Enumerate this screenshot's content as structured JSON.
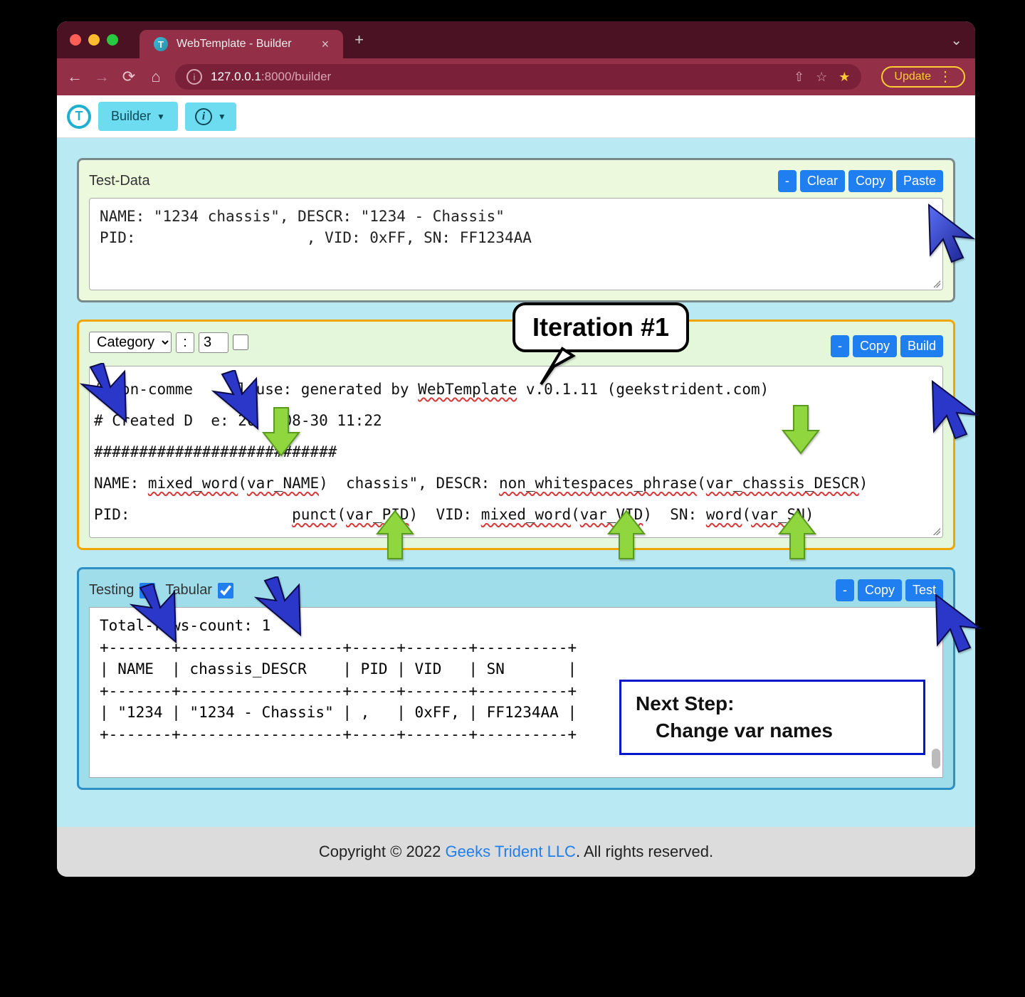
{
  "browser": {
    "tab_title": "WebTemplate - Builder",
    "url_host": "127.0.0.1",
    "url_port": ":8000",
    "url_path": "/builder",
    "update_label": "Update"
  },
  "appbar": {
    "builder_label": "Builder",
    "info_label": "i"
  },
  "panel1": {
    "title": "Test-Data",
    "btn_minus": "-",
    "btn_clear": "Clear",
    "btn_copy": "Copy",
    "btn_paste": "Paste",
    "content": "NAME: \"1234 chassis\", DESCR: \"1234 - Chassis\"\nPID:                   , VID: 0xFF, SN: FF1234AA"
  },
  "panel2": {
    "category_label": "Category",
    "colon": ":",
    "number_value": "3",
    "btn_minus": "-",
    "btn_copy": "Copy",
    "btn_build": "Build",
    "line1_a": "# Non-comme",
    "line1_b": "l use: generated by ",
    "line1_link": "WebTemplate",
    "line1_c": " v.0.1.11 (geekstrident.com)",
    "line2_a": "# Created D",
    "line2_b": "e: 20",
    "line2_c": "08-30 11:22",
    "line3": "###########################",
    "line4_a": "NAME: ",
    "line4_tok1": "mixed_word",
    "line4_b": "(",
    "line4_var1": "var_NAME",
    "line4_c": ")  chassis\", DESCR: ",
    "line4_tok2": "non_whitespaces_phrase",
    "line4_d": "(",
    "line4_var2": "var_chassis_DESCR",
    "line4_e": ")",
    "line5_a": "PID:                  ",
    "line5_tok1": "punct",
    "line5_b": "(",
    "line5_var1": "var_PID",
    "line5_c": ")  VID: ",
    "line5_tok2": "mixed_word",
    "line5_d": "(",
    "line5_var2": "var_VID",
    "line5_e": ")  SN: ",
    "line5_tok3": "word",
    "line5_f": "(",
    "line5_var3": "var_SN",
    "line5_g": ")"
  },
  "panel3": {
    "testing_label": "Testing",
    "tabular_label": "Tabular",
    "btn_minus": "-",
    "btn_copy": "Copy",
    "btn_test": "Test",
    "content": "Total-rows-count: 1\n+-------+------------------+-----+-------+----------+\n| NAME  | chassis_DESCR    | PID | VID   | SN       |\n+-------+------------------+-----+-------+----------+\n| \"1234 | \"1234 - Chassis\" | ,   | 0xFF, | FF1234AA |\n+-------+------------------+-----+-------+----------+"
  },
  "callout_iteration": "Iteration #1",
  "next_step": {
    "line1": "Next Step:",
    "line2": "Change var names"
  },
  "footer": {
    "prefix": "Copyright © 2022 ",
    "link": "Geeks Trident LLC",
    "suffix": ". All rights reserved."
  }
}
